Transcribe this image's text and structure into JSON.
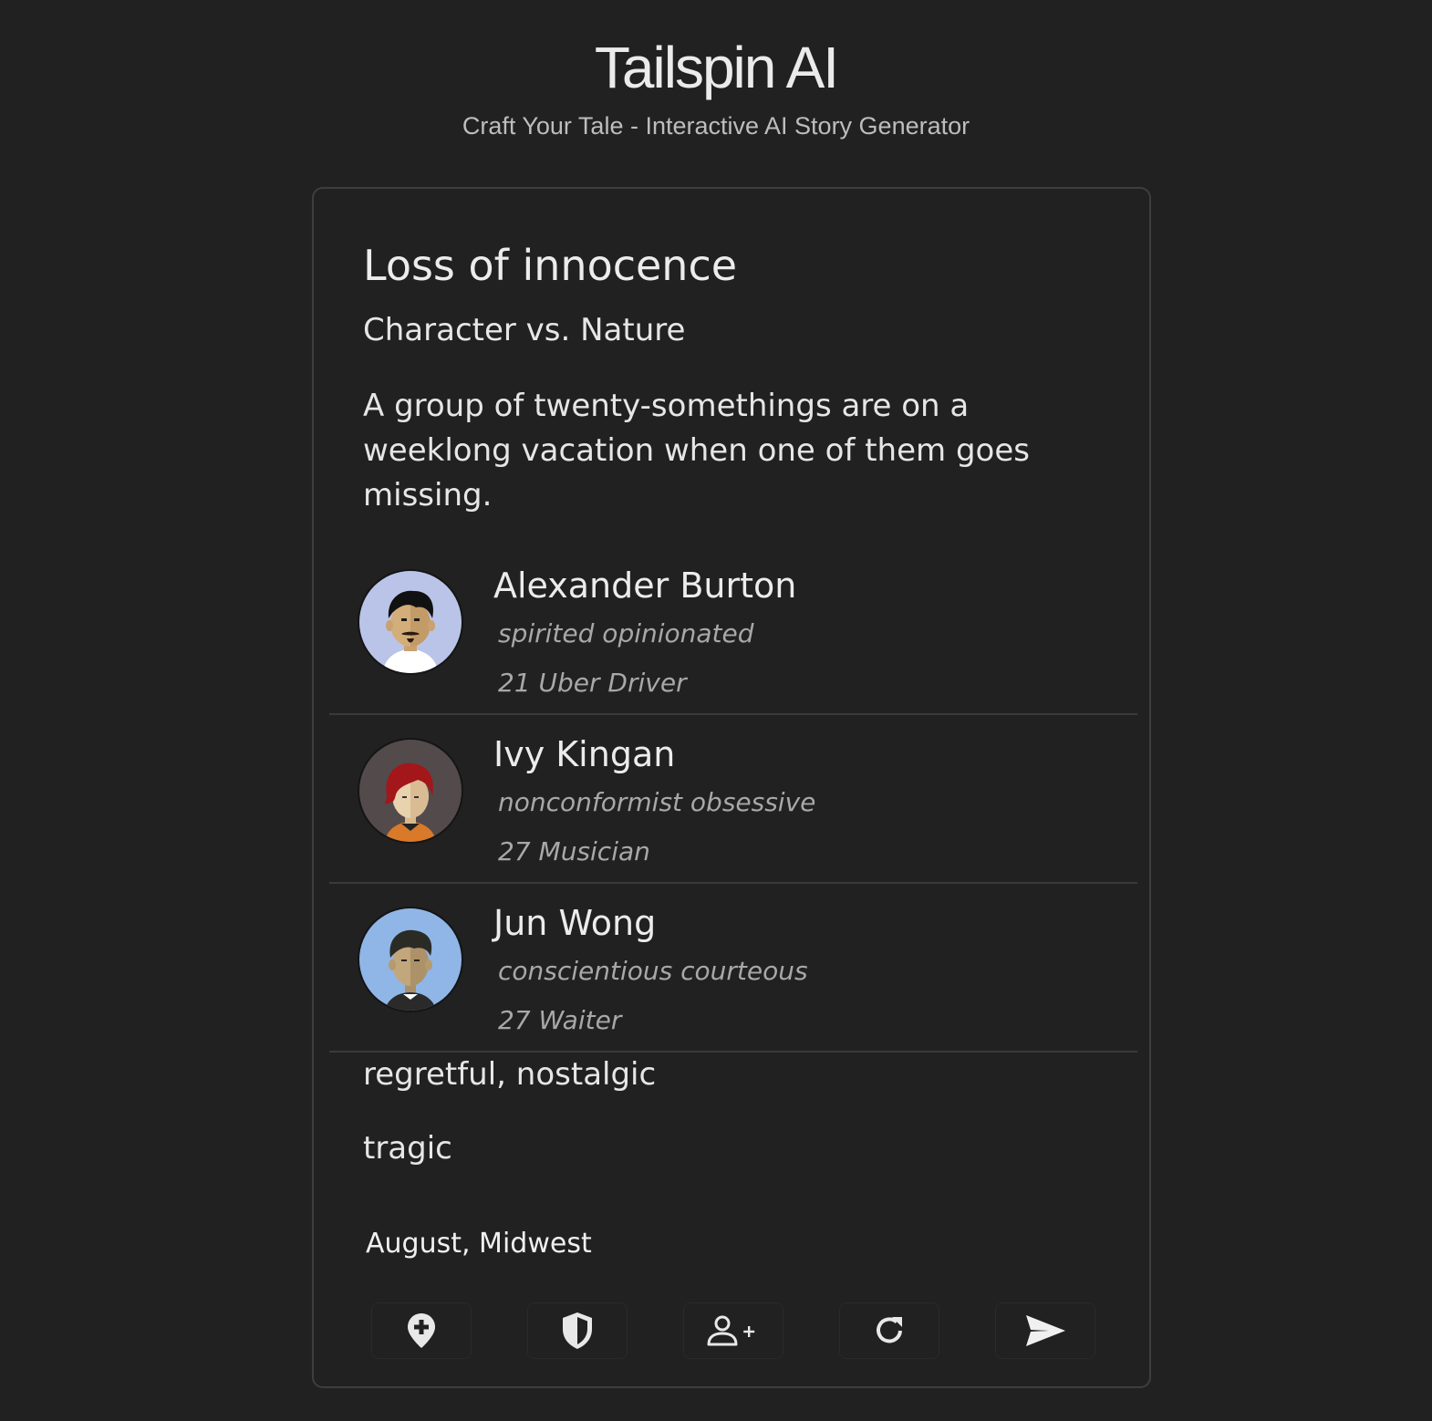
{
  "app": {
    "title": "Tailspin AI",
    "subtitle": "Craft Your Tale - Interactive AI Story Generator"
  },
  "story": {
    "title": "Loss of innocence",
    "conflict": "Character vs. Nature",
    "premise": "A group of twenty-somethings are on a weeklong vacation when one of them goes missing.",
    "characters": [
      {
        "name": "Alexander Burton",
        "traits": "spirited opinionated",
        "age_occupation": "21 Uber Driver",
        "avatar_bg": "#b9c4e8"
      },
      {
        "name": "Ivy Kingan",
        "traits": "nonconformist obsessive",
        "age_occupation": "27 Musician",
        "avatar_bg": "#534a4c"
      },
      {
        "name": "Jun Wong",
        "traits": "conscientious courteous",
        "age_occupation": "27 Waiter",
        "avatar_bg": "#8fb6e6"
      }
    ],
    "mood": "regretful, nostalgic",
    "genre": "tragic",
    "setting": "August, Midwest"
  },
  "actions": [
    {
      "icon": "add-location-icon"
    },
    {
      "icon": "shield-icon"
    },
    {
      "icon": "add-person-icon"
    },
    {
      "icon": "refresh-icon"
    },
    {
      "icon": "send-icon"
    }
  ],
  "colors": {
    "background": "#212121",
    "card_border": "#3e3e3e",
    "text": "#e6e6e6",
    "muted": "#a8a8a8"
  }
}
